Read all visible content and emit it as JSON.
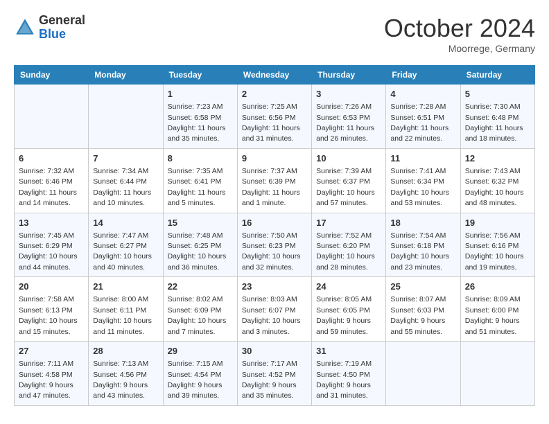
{
  "header": {
    "logo": {
      "general": "General",
      "blue": "Blue"
    },
    "month": "October 2024",
    "location": "Moorrege, Germany"
  },
  "weekdays": [
    "Sunday",
    "Monday",
    "Tuesday",
    "Wednesday",
    "Thursday",
    "Friday",
    "Saturday"
  ],
  "weeks": [
    [
      {
        "day": null,
        "sunrise": null,
        "sunset": null,
        "daylight": null
      },
      {
        "day": null,
        "sunrise": null,
        "sunset": null,
        "daylight": null
      },
      {
        "day": 1,
        "sunrise": "Sunrise: 7:23 AM",
        "sunset": "Sunset: 6:58 PM",
        "daylight": "Daylight: 11 hours and 35 minutes."
      },
      {
        "day": 2,
        "sunrise": "Sunrise: 7:25 AM",
        "sunset": "Sunset: 6:56 PM",
        "daylight": "Daylight: 11 hours and 31 minutes."
      },
      {
        "day": 3,
        "sunrise": "Sunrise: 7:26 AM",
        "sunset": "Sunset: 6:53 PM",
        "daylight": "Daylight: 11 hours and 26 minutes."
      },
      {
        "day": 4,
        "sunrise": "Sunrise: 7:28 AM",
        "sunset": "Sunset: 6:51 PM",
        "daylight": "Daylight: 11 hours and 22 minutes."
      },
      {
        "day": 5,
        "sunrise": "Sunrise: 7:30 AM",
        "sunset": "Sunset: 6:48 PM",
        "daylight": "Daylight: 11 hours and 18 minutes."
      }
    ],
    [
      {
        "day": 6,
        "sunrise": "Sunrise: 7:32 AM",
        "sunset": "Sunset: 6:46 PM",
        "daylight": "Daylight: 11 hours and 14 minutes."
      },
      {
        "day": 7,
        "sunrise": "Sunrise: 7:34 AM",
        "sunset": "Sunset: 6:44 PM",
        "daylight": "Daylight: 11 hours and 10 minutes."
      },
      {
        "day": 8,
        "sunrise": "Sunrise: 7:35 AM",
        "sunset": "Sunset: 6:41 PM",
        "daylight": "Daylight: 11 hours and 5 minutes."
      },
      {
        "day": 9,
        "sunrise": "Sunrise: 7:37 AM",
        "sunset": "Sunset: 6:39 PM",
        "daylight": "Daylight: 11 hours and 1 minute."
      },
      {
        "day": 10,
        "sunrise": "Sunrise: 7:39 AM",
        "sunset": "Sunset: 6:37 PM",
        "daylight": "Daylight: 10 hours and 57 minutes."
      },
      {
        "day": 11,
        "sunrise": "Sunrise: 7:41 AM",
        "sunset": "Sunset: 6:34 PM",
        "daylight": "Daylight: 10 hours and 53 minutes."
      },
      {
        "day": 12,
        "sunrise": "Sunrise: 7:43 AM",
        "sunset": "Sunset: 6:32 PM",
        "daylight": "Daylight: 10 hours and 48 minutes."
      }
    ],
    [
      {
        "day": 13,
        "sunrise": "Sunrise: 7:45 AM",
        "sunset": "Sunset: 6:29 PM",
        "daylight": "Daylight: 10 hours and 44 minutes."
      },
      {
        "day": 14,
        "sunrise": "Sunrise: 7:47 AM",
        "sunset": "Sunset: 6:27 PM",
        "daylight": "Daylight: 10 hours and 40 minutes."
      },
      {
        "day": 15,
        "sunrise": "Sunrise: 7:48 AM",
        "sunset": "Sunset: 6:25 PM",
        "daylight": "Daylight: 10 hours and 36 minutes."
      },
      {
        "day": 16,
        "sunrise": "Sunrise: 7:50 AM",
        "sunset": "Sunset: 6:23 PM",
        "daylight": "Daylight: 10 hours and 32 minutes."
      },
      {
        "day": 17,
        "sunrise": "Sunrise: 7:52 AM",
        "sunset": "Sunset: 6:20 PM",
        "daylight": "Daylight: 10 hours and 28 minutes."
      },
      {
        "day": 18,
        "sunrise": "Sunrise: 7:54 AM",
        "sunset": "Sunset: 6:18 PM",
        "daylight": "Daylight: 10 hours and 23 minutes."
      },
      {
        "day": 19,
        "sunrise": "Sunrise: 7:56 AM",
        "sunset": "Sunset: 6:16 PM",
        "daylight": "Daylight: 10 hours and 19 minutes."
      }
    ],
    [
      {
        "day": 20,
        "sunrise": "Sunrise: 7:58 AM",
        "sunset": "Sunset: 6:13 PM",
        "daylight": "Daylight: 10 hours and 15 minutes."
      },
      {
        "day": 21,
        "sunrise": "Sunrise: 8:00 AM",
        "sunset": "Sunset: 6:11 PM",
        "daylight": "Daylight: 10 hours and 11 minutes."
      },
      {
        "day": 22,
        "sunrise": "Sunrise: 8:02 AM",
        "sunset": "Sunset: 6:09 PM",
        "daylight": "Daylight: 10 hours and 7 minutes."
      },
      {
        "day": 23,
        "sunrise": "Sunrise: 8:03 AM",
        "sunset": "Sunset: 6:07 PM",
        "daylight": "Daylight: 10 hours and 3 minutes."
      },
      {
        "day": 24,
        "sunrise": "Sunrise: 8:05 AM",
        "sunset": "Sunset: 6:05 PM",
        "daylight": "Daylight: 9 hours and 59 minutes."
      },
      {
        "day": 25,
        "sunrise": "Sunrise: 8:07 AM",
        "sunset": "Sunset: 6:03 PM",
        "daylight": "Daylight: 9 hours and 55 minutes."
      },
      {
        "day": 26,
        "sunrise": "Sunrise: 8:09 AM",
        "sunset": "Sunset: 6:00 PM",
        "daylight": "Daylight: 9 hours and 51 minutes."
      }
    ],
    [
      {
        "day": 27,
        "sunrise": "Sunrise: 7:11 AM",
        "sunset": "Sunset: 4:58 PM",
        "daylight": "Daylight: 9 hours and 47 minutes."
      },
      {
        "day": 28,
        "sunrise": "Sunrise: 7:13 AM",
        "sunset": "Sunset: 4:56 PM",
        "daylight": "Daylight: 9 hours and 43 minutes."
      },
      {
        "day": 29,
        "sunrise": "Sunrise: 7:15 AM",
        "sunset": "Sunset: 4:54 PM",
        "daylight": "Daylight: 9 hours and 39 minutes."
      },
      {
        "day": 30,
        "sunrise": "Sunrise: 7:17 AM",
        "sunset": "Sunset: 4:52 PM",
        "daylight": "Daylight: 9 hours and 35 minutes."
      },
      {
        "day": 31,
        "sunrise": "Sunrise: 7:19 AM",
        "sunset": "Sunset: 4:50 PM",
        "daylight": "Daylight: 9 hours and 31 minutes."
      },
      {
        "day": null,
        "sunrise": null,
        "sunset": null,
        "daylight": null
      },
      {
        "day": null,
        "sunrise": null,
        "sunset": null,
        "daylight": null
      }
    ]
  ]
}
